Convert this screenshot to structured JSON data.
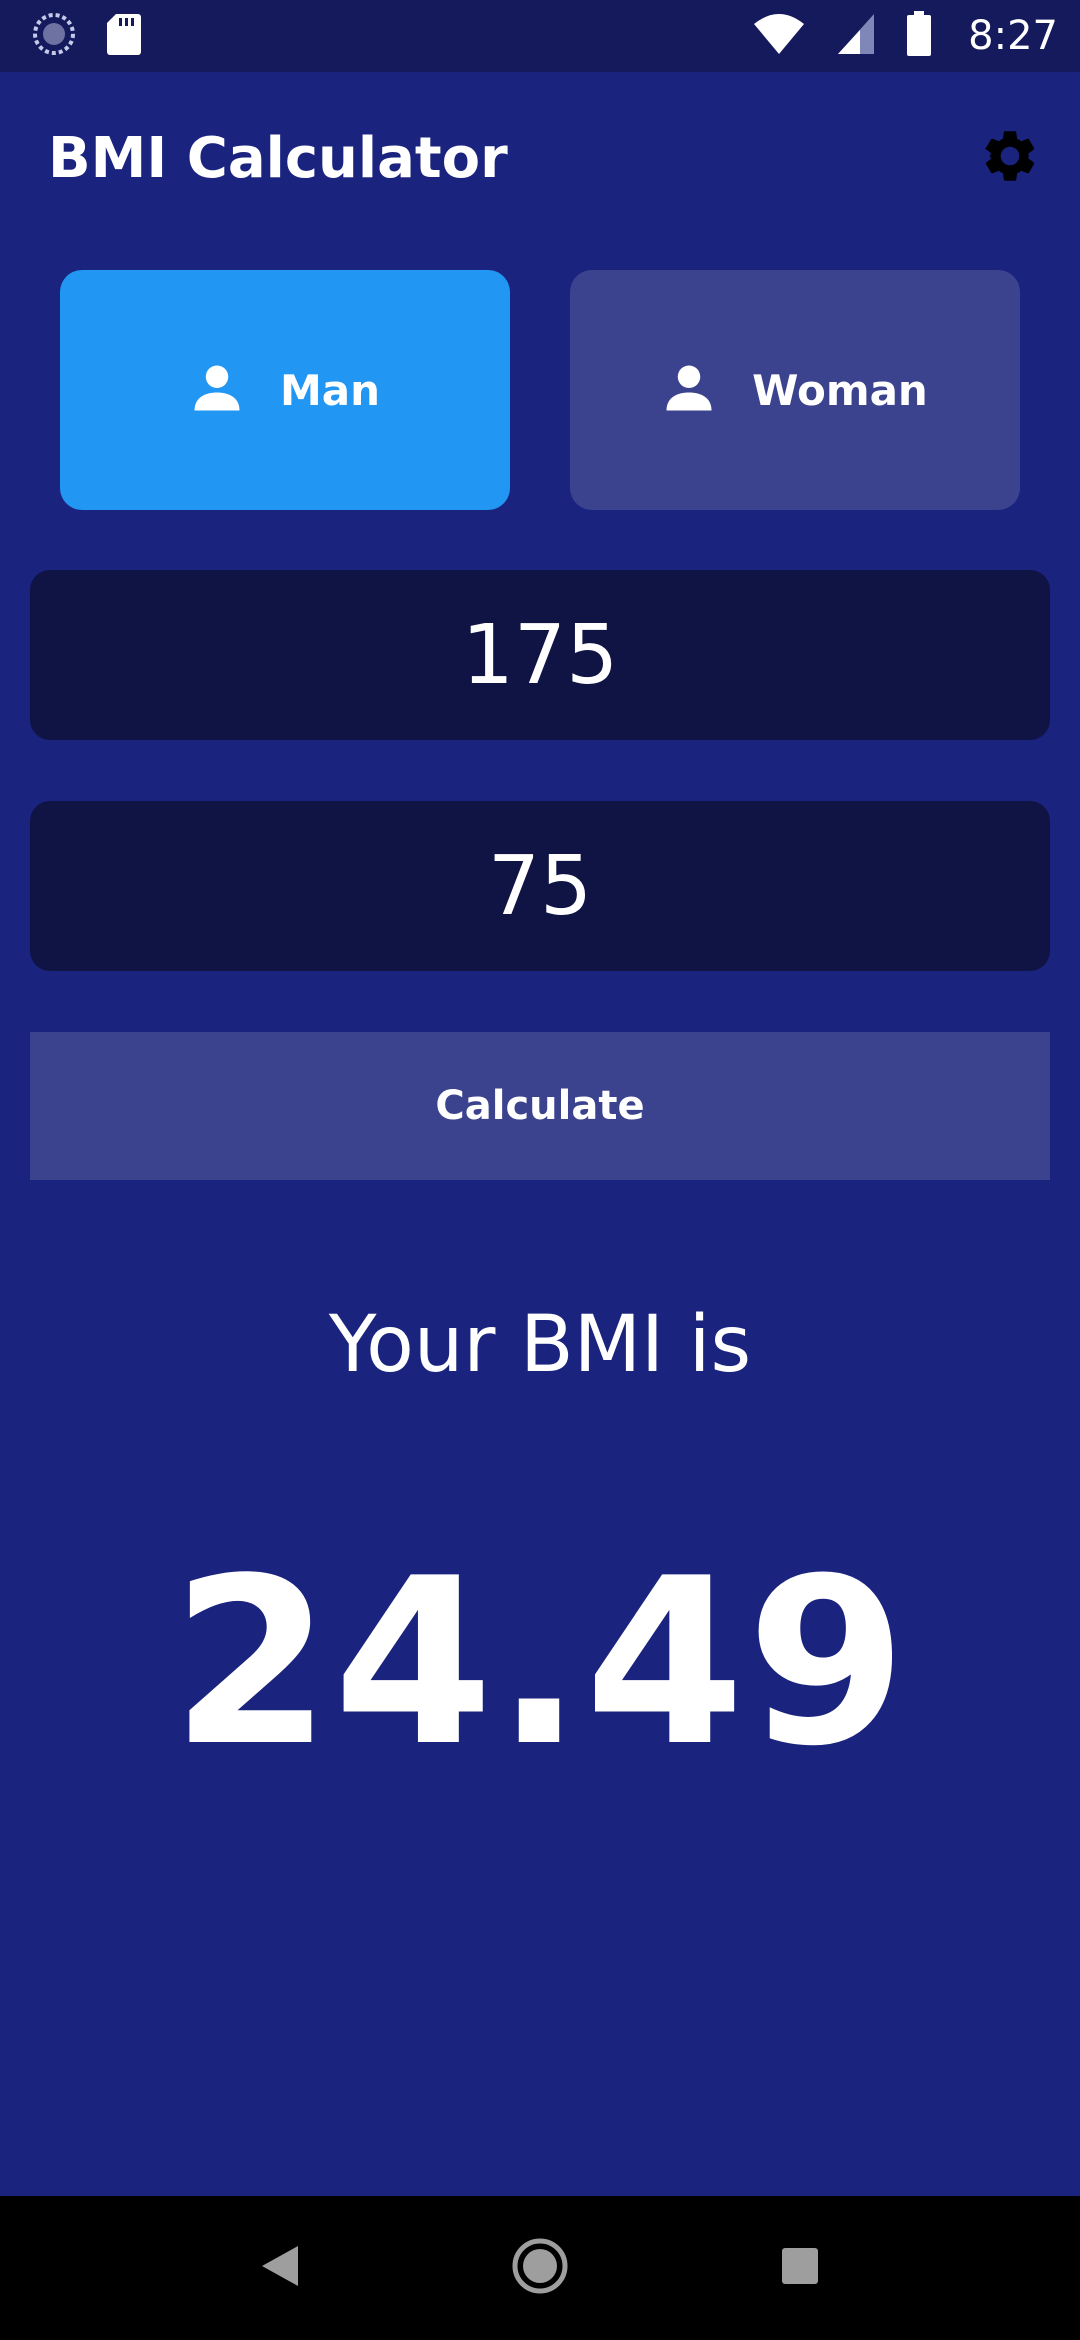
{
  "status_bar": {
    "time": "8:27",
    "icons": [
      "sync-icon",
      "sd-card-icon",
      "wifi-icon",
      "signal-icon",
      "battery-icon"
    ]
  },
  "app_bar": {
    "title": "BMI Calculator",
    "settings_icon": "gear-icon"
  },
  "gender": {
    "selected": "man",
    "man_label": "Man",
    "woman_label": "Woman",
    "icon": "person-icon"
  },
  "inputs": {
    "height_value": "175",
    "weight_value": "75"
  },
  "calculate": {
    "label": "Calculate"
  },
  "result": {
    "label": "Your BMI is",
    "value": "24.49"
  },
  "nav_bar": {
    "icons": [
      "back-icon",
      "home-icon",
      "recents-icon"
    ]
  },
  "colors": {
    "background": "#1a237e",
    "status_bar": "#141a5c",
    "selected_card": "#2196f3",
    "unselected_card": "#3c438e",
    "input_bg": "#0f1445",
    "button_bg": "#3c438e"
  }
}
